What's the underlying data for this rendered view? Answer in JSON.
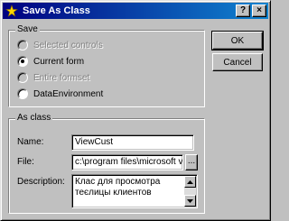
{
  "window": {
    "title": "Save As Class",
    "help_label": "?",
    "close_label": "×"
  },
  "save_group": {
    "legend": "Save",
    "options": [
      {
        "label": "Selected controls",
        "checked": false,
        "enabled": false
      },
      {
        "label": "Current form",
        "checked": true,
        "enabled": true
      },
      {
        "label": "Entire formset",
        "checked": false,
        "enabled": false
      },
      {
        "label": "DataEnvironment",
        "checked": false,
        "enabled": true
      }
    ]
  },
  "asclass_group": {
    "legend": "As class",
    "name_label": "Name:",
    "name_value": "ViewCust",
    "file_label": "File:",
    "file_value": "c:\\program files\\microsoft vi",
    "browse_label": "...",
    "description_label": "Description:",
    "description_value": "Клас для просмотра теєлицы клиентов"
  },
  "buttons": {
    "ok_label": "OK",
    "cancel_label": "Cancel"
  },
  "colors": {
    "title_start": "#000080",
    "title_end": "#1084d0",
    "face": "#c0c0c0"
  }
}
